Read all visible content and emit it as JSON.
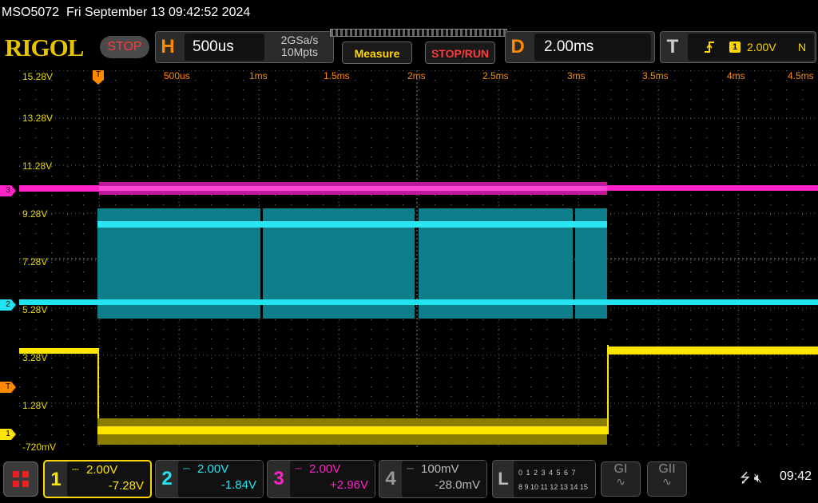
{
  "title_bar": {
    "model": "MSO5072",
    "datetime": "Fri September 13 09:42:52 2024"
  },
  "header": {
    "logo": "RIGOL",
    "run_state": "STOP",
    "horizontal": {
      "letter": "H",
      "timebase": "500us",
      "sample_rate": "2GSa/s",
      "memory_depth": "10Mpts"
    },
    "measure_label": "Measure",
    "stoprun_label": "STOP/RUN",
    "delay": {
      "letter": "D",
      "value": "2.00ms"
    },
    "trigger": {
      "letter": "T",
      "edge_icon": "rising-edge-icon",
      "source": "1",
      "level": "2.00V",
      "mode": "N"
    }
  },
  "y_axis_labels": [
    "15.28V",
    "13.28V",
    "11.28V",
    "9.28V",
    "7.28V",
    "5.28V",
    "3.28V",
    "1.28V",
    "-720mV"
  ],
  "x_axis_labels": [
    "500us",
    "1ms",
    "1.5ms",
    "2ms",
    "2.5ms",
    "3ms",
    "3.5ms",
    "4ms",
    "4.5ms"
  ],
  "channel_markers": {
    "ch3": "3",
    "ch2": "2",
    "trigger": "T",
    "ch1": "1"
  },
  "channels": [
    {
      "num": "1",
      "coupling": "DC",
      "scale": "2.00V",
      "offset": "-7.28V",
      "color": "#ffe600",
      "active": true
    },
    {
      "num": "2",
      "coupling": "DC",
      "scale": "2.00V",
      "offset": "-1.84V",
      "color": "#22e4f0",
      "active": false
    },
    {
      "num": "3",
      "coupling": "DC",
      "scale": "2.00V",
      "offset": "+2.96V",
      "color": "#ff22c8",
      "active": false
    },
    {
      "num": "4",
      "coupling": "DC",
      "scale": "100mV",
      "offset": "-28.0mV",
      "color": "#9a9a9a",
      "active": false
    }
  ],
  "logic": {
    "label": "L",
    "row1": "0 1 2 3  4 5 6 7",
    "row2": "8 9 10 11 12 13 14 15"
  },
  "generators": [
    "GI",
    "GII"
  ],
  "status": {
    "usb_icon": "usb-icon",
    "sound_icon": "speaker-muted-icon",
    "clock": "09:42"
  },
  "colors": {
    "ch1": "#ffe600",
    "ch2": "#22e4f0",
    "ch3": "#ff22c8",
    "trigger": "#ff8a00",
    "stop": "#ff3b3b"
  }
}
